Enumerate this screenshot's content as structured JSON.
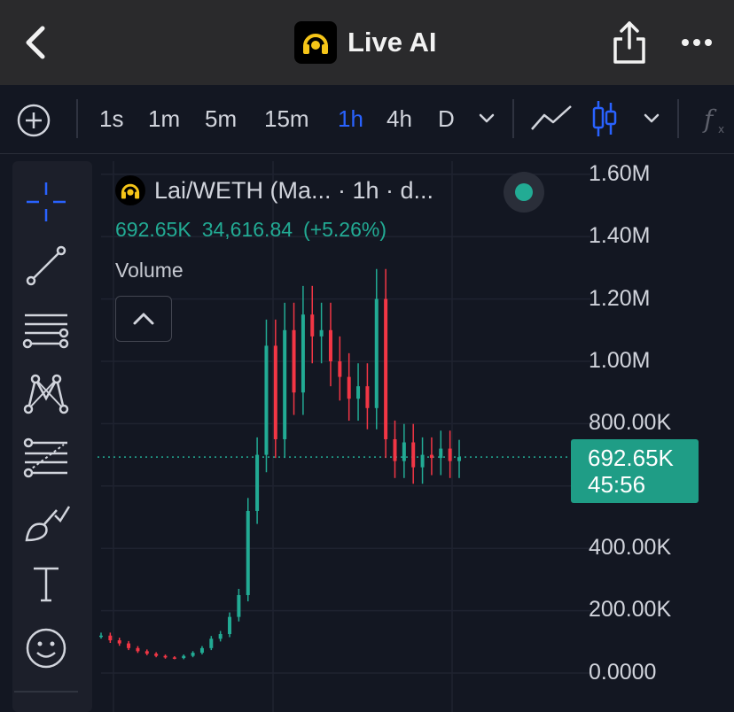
{
  "appbar": {
    "title": "Live AI",
    "back_icon": "chevron-left-icon",
    "share_icon": "share-icon",
    "more_icon": "more-horizontal-icon"
  },
  "toolbar": {
    "timeframes": [
      "1s",
      "1m",
      "5m",
      "15m",
      "1h",
      "4h",
      "D"
    ],
    "active_timeframe": "1h",
    "icons": [
      "add-circle-icon",
      "chevron-down-icon",
      "line-chart-icon",
      "candlestick-icon",
      "chevron-down-icon",
      "indicators-fx-icon"
    ]
  },
  "left_tools": [
    "crosshair-icon",
    "trend-line-icon",
    "horizontal-lines-icon",
    "pattern-icon",
    "fib-retracement-icon",
    "brush-icon",
    "text-tool-icon",
    "emoji-icon"
  ],
  "legend": {
    "title": "Lai/WETH (Ma... · 1h · d...",
    "last": "692.65K",
    "change": "34,616.84",
    "change_pct": "(+5.26%)",
    "volume_label": "Volume"
  },
  "price_tag": {
    "price": "692.65K",
    "countdown": "45:56"
  },
  "colors": {
    "up": "#22ab94",
    "down": "#f23645",
    "active": "#2962ff",
    "tag": "#1f9d86"
  },
  "chart_data": {
    "type": "line",
    "title": "Lai/WETH (Ma... · 1h · d...",
    "y_ticks": [
      "1.60M",
      "1.40M",
      "1.20M",
      "1.00M",
      "800.00K",
      "400.00K",
      "200.00K",
      "0.0000"
    ],
    "ylim": [
      0,
      1650000
    ],
    "last_price": 692650,
    "series": [
      {
        "values": [
          120000,
          105000,
          95000,
          80000,
          70000,
          62000,
          55000,
          50000,
          48000,
          55000,
          65000,
          80000,
          110000,
          125000,
          180000,
          250000,
          520000,
          700000,
          1050000,
          750000,
          1100000,
          900000,
          1150000,
          1080000,
          1100000,
          1000000,
          950000,
          880000,
          920000,
          850000,
          1200000,
          750000,
          680000,
          740000,
          660000,
          700000,
          690000,
          720000,
          680000,
          692650
        ]
      }
    ]
  }
}
